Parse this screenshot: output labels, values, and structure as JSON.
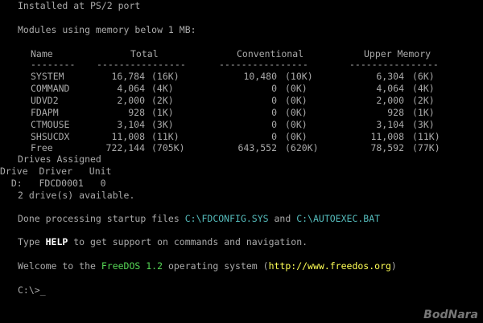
{
  "lines": {
    "installed": "Installed at PS/2 port",
    "modules_heading": "Modules using memory below 1 MB:",
    "drives_assigned": "Drives Assigned",
    "drive_header": "Drive  Driver   Unit",
    "drive_row": "  D:   FDCD0001   0",
    "drive_count": "2 drive(s) available."
  },
  "table": {
    "headers": {
      "name": "Name",
      "total": "Total",
      "conventional": "Conventional",
      "upper": "Upper Memory"
    },
    "dashes": {
      "name": "--------",
      "total": "----------------",
      "conventional": "----------------",
      "upper": "----------------"
    },
    "rows": [
      {
        "name": "SYSTEM",
        "total": "16,784",
        "total_k": "(16K)",
        "conv": "10,480",
        "conv_k": "(10K)",
        "upper": "6,304",
        "upper_k": "(6K)"
      },
      {
        "name": "COMMAND",
        "total": "4,064",
        "total_k": "(4K)",
        "conv": "0",
        "conv_k": "(0K)",
        "upper": "4,064",
        "upper_k": "(4K)"
      },
      {
        "name": "UDVD2",
        "total": "2,000",
        "total_k": "(2K)",
        "conv": "0",
        "conv_k": "(0K)",
        "upper": "2,000",
        "upper_k": "(2K)"
      },
      {
        "name": "FDAPM",
        "total": "928",
        "total_k": "(1K)",
        "conv": "0",
        "conv_k": "(0K)",
        "upper": "928",
        "upper_k": "(1K)"
      },
      {
        "name": "CTMOUSE",
        "total": "3,104",
        "total_k": "(3K)",
        "conv": "0",
        "conv_k": "(0K)",
        "upper": "3,104",
        "upper_k": "(3K)"
      },
      {
        "name": "SHSUCDX",
        "total": "11,008",
        "total_k": "(11K)",
        "conv": "0",
        "conv_k": "(0K)",
        "upper": "11,008",
        "upper_k": "(11K)"
      },
      {
        "name": "Free",
        "total": "722,144",
        "total_k": "(705K)",
        "conv": "643,552",
        "conv_k": "(620K)",
        "upper": "78,592",
        "upper_k": "(77K)"
      }
    ]
  },
  "startup": {
    "prefix": "Done processing startup files ",
    "config": "C:\\FDCONFIG.SYS",
    "and": " and ",
    "autoexec": "C:\\AUTOEXEC.BAT"
  },
  "help": {
    "prefix": "Type ",
    "keyword": "HELP",
    "suffix": " to get support on commands and navigation."
  },
  "welcome": {
    "prefix": "Welcome to the ",
    "os_name": "FreeDOS 1.2",
    "middle": " operating system (",
    "url": "http://www.freedos.org",
    "suffix": ")"
  },
  "prompt": {
    "text": "C:\\>",
    "cursor": "_"
  },
  "watermark": "BodNara",
  "colors": {
    "background": "#000000",
    "text": "#aaaaaa",
    "path": "#55bcbc",
    "os": "#55d655",
    "url": "#ffff55"
  }
}
